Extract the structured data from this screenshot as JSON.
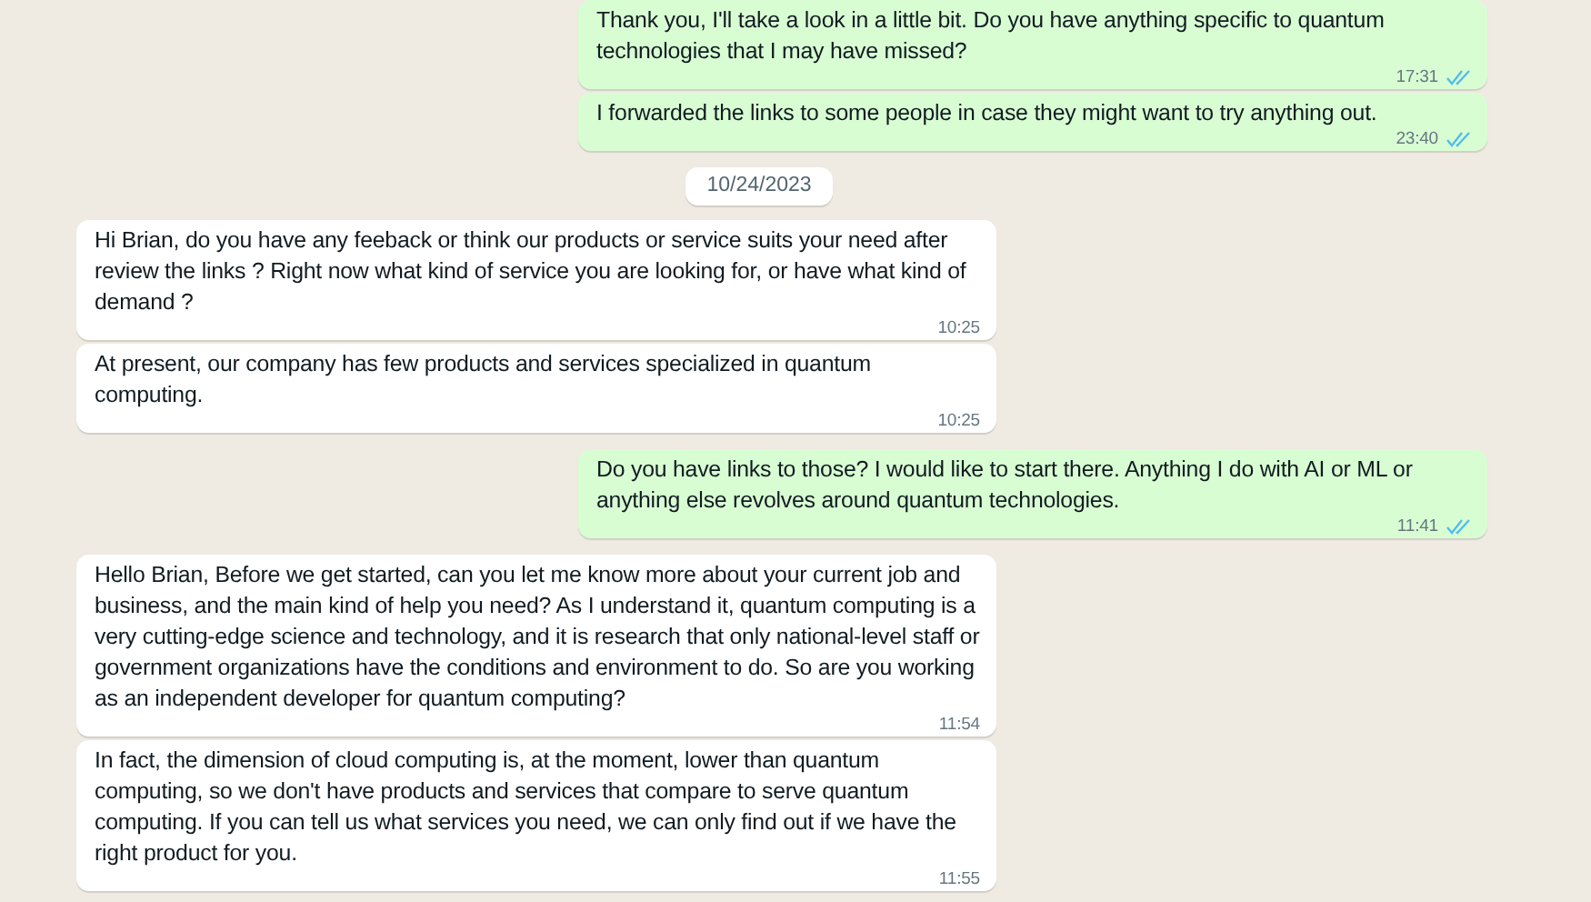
{
  "messages": [
    {
      "kind": "out",
      "text": "Thank you, I'll take a look in a little bit. Do you have anything specific to quantum technologies that I may have missed?",
      "time": "17:31",
      "read": true
    },
    {
      "kind": "out",
      "text": "I forwarded the links to some people in case they might want to try anything out.",
      "time": "23:40",
      "read": true
    },
    {
      "kind": "date",
      "text": "10/24/2023"
    },
    {
      "kind": "in",
      "text": "Hi Brian, do you have any feeback or think our products or service suits your need after review the links ? Right now what kind of service you are looking for, or have what kind of demand ?",
      "time": "10:25"
    },
    {
      "kind": "in",
      "text": "At present, our company has few products and services specialized in quantum computing.",
      "time": "10:25"
    },
    {
      "kind": "out",
      "text": "Do you have links to those? I would like to start there. Anything I do with AI or ML or anything else revolves around quantum technologies.",
      "time": "11:41",
      "read": true
    },
    {
      "kind": "in",
      "text": "Hello Brian, Before we get started, can you let me know more about your current job and business, and the main kind of help you need? As I understand it, quantum computing is a very cutting-edge science and technology, and it is research that only national-level staff or government organizations have the conditions and environment to do. So are you working as an independent developer for quantum computing?",
      "time": "11:54"
    },
    {
      "kind": "in",
      "text": "In fact, the dimension of cloud computing is, at the moment, lower than quantum computing, so we don't have products and services that compare to serve quantum computing. If you can tell us what services you need, we can only find out if we have the right product for you.",
      "time": "11:55"
    }
  ]
}
